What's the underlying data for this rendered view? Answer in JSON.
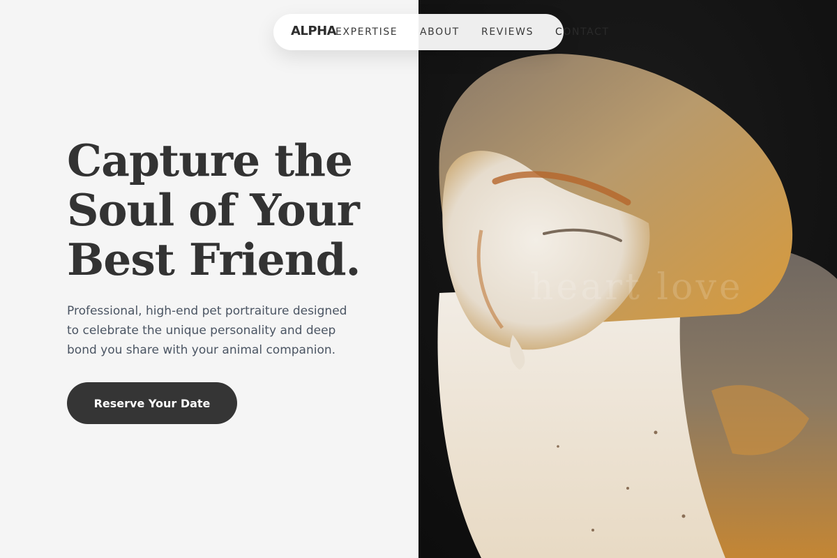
{
  "brand": {
    "name": "ALPHA"
  },
  "nav": {
    "links": [
      "EXPERTISE",
      "ABOUT",
      "REVIEWS",
      "CONTACT"
    ]
  },
  "hero": {
    "headline_lines": [
      "Capture the",
      "Soul of Your",
      "Best Friend."
    ],
    "subtitle": "Professional, high-end pet portraiture designed to celebrate the unique personality and deep bond you share with your animal companion.",
    "cta_label": "Reserve Your Date",
    "image_subject": "barn-owl-portrait",
    "watermark": "heart love"
  },
  "colors": {
    "page_background": "#f5f5f5",
    "headline_text": "#333333",
    "body_text": "#4b5563",
    "cta_background": "#353535",
    "cta_text": "#ffffff",
    "image_background": "#121212"
  }
}
